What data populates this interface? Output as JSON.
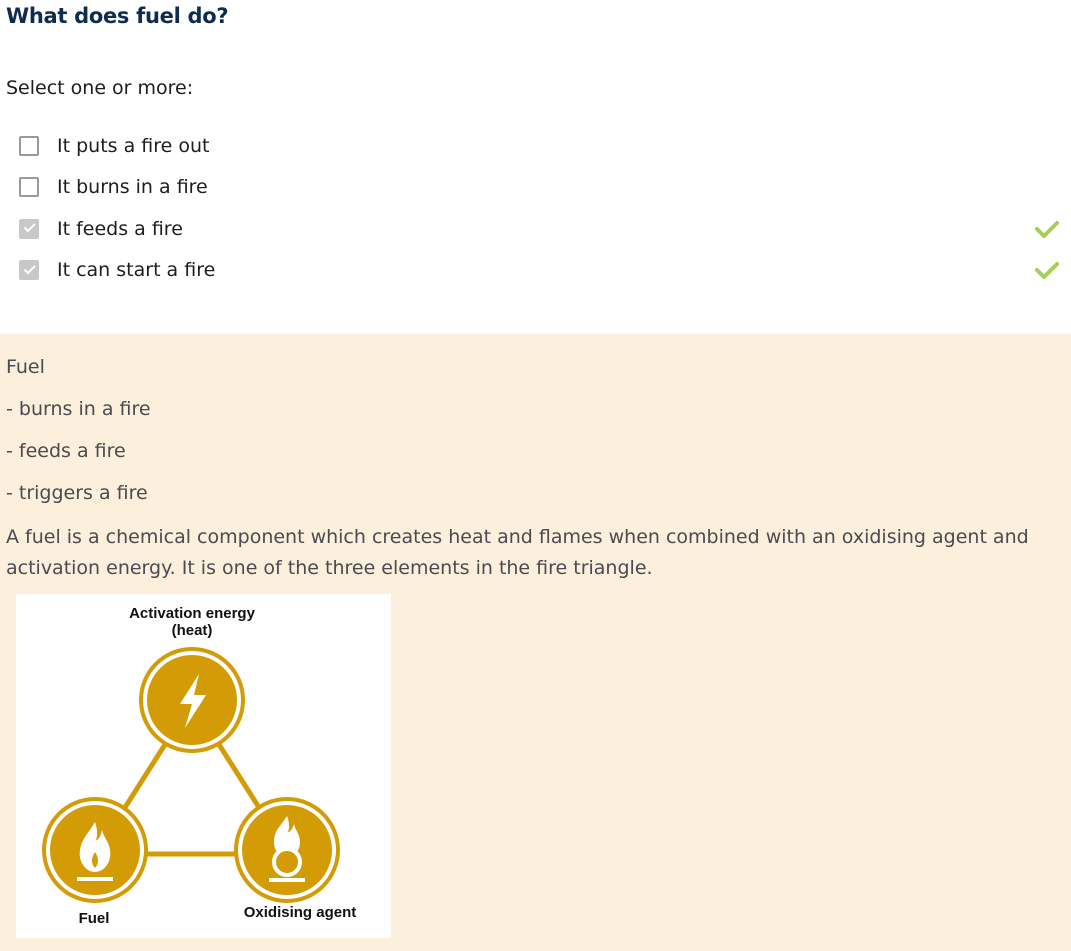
{
  "question": {
    "title": "What does fuel do?",
    "prompt": "Select one or more:"
  },
  "options": [
    {
      "label": "It puts a fire out",
      "checked": false,
      "correct": false
    },
    {
      "label": "It burns in a fire",
      "checked": false,
      "correct": false
    },
    {
      "label": "It feeds a fire",
      "checked": true,
      "correct": true
    },
    {
      "label": "It can start a fire",
      "checked": true,
      "correct": true
    }
  ],
  "feedback": {
    "heading": "Fuel",
    "bullets": [
      "- burns in a fire",
      "- feeds a fire",
      "- triggers a fire"
    ],
    "paragraph": "A fuel is a chemical component which creates heat and flames when combined with an oxidising agent and activation energy. It is one of the three elements in the fire triangle."
  },
  "diagram": {
    "top_label_line1": "Activation energy",
    "top_label_line2": "(heat)",
    "left_label": "Fuel",
    "right_label": "Oxidising agent",
    "color_gold": "#d39c07",
    "icons": [
      "lightning-icon",
      "flame-icon",
      "oxidiser-icon"
    ]
  },
  "colors": {
    "title": "#0f2c4f",
    "feedback_bg": "#fcefdc",
    "correct_tick": "#a4cf55"
  }
}
